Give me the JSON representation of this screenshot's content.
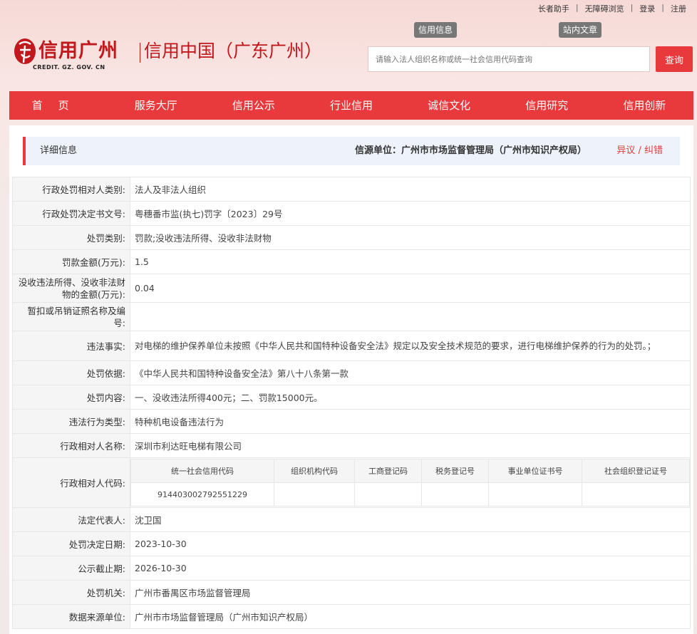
{
  "top_links": [
    "长者助手",
    "无障碍浏览",
    "登录",
    "注册"
  ],
  "logo": {
    "main": "信用广州",
    "sub": "CREDIT. GZ. GOV. CN",
    "secondary": "信用中国（广东广州）"
  },
  "search": {
    "tags": [
      "信用信息",
      "站内文章"
    ],
    "placeholder": "请输入法人组织名称或统一社会信用代码查询",
    "button": "查询"
  },
  "nav": [
    "首页",
    "服务大厅",
    "信用公示",
    "行业信用",
    "诚信文化",
    "信用研究",
    "信用创新"
  ],
  "detail": {
    "title": "详细信息",
    "source": "信源单位：广州市市场监督管理局（广州市知识产权局）",
    "action": "异议 / 纠错"
  },
  "rows": [
    {
      "k": "行政处罚相对人类别:",
      "v": "法人及非法人组织"
    },
    {
      "k": "行政处罚决定书文号:",
      "v": "粤穗番市监(执七)罚字〔2023〕29号"
    },
    {
      "k": "处罚类别:",
      "v": "罚款;没收违法所得、没收非法财物"
    },
    {
      "k": "罚款金额(万元):",
      "v": "1.5"
    },
    {
      "k": "没收违法所得、没收非法财物的金额(万元):",
      "v": "0.04"
    },
    {
      "k": "暂扣或吊销证照名称及编号:",
      "v": ""
    },
    {
      "k": "违法事实:",
      "v": "对电梯的维护保养单位未按照《中华人民共和国特种设备安全法》规定以及安全技术规范的要求，进行电梯维护保养的行为的处罚。；"
    },
    {
      "k": "处罚依据:",
      "v": "《中华人民共和国特种设备安全法》第八十八条第一款"
    },
    {
      "k": "处罚内容:",
      "v": "一、没收违法所得400元；二、罚款15000元。"
    },
    {
      "k": "违法行为类型:",
      "v": "特种机电设备违法行为"
    },
    {
      "k": "行政相对人名称:",
      "v": "深圳市利达旺电梯有限公司"
    }
  ],
  "code_row": {
    "k": "行政相对人代码:",
    "headers": [
      "统一社会信用代码",
      "组织机构代码",
      "工商登记码",
      "税务登记号",
      "事业单位证书号",
      "社会组织登记证号"
    ],
    "values": [
      "914403002792551229",
      "",
      "",
      "",
      "",
      ""
    ]
  },
  "rows2": [
    {
      "k": "法定代表人:",
      "v": "沈卫国"
    },
    {
      "k": "处罚决定日期:",
      "v": "2023-10-30"
    },
    {
      "k": "公示截止期:",
      "v": "2026-10-30"
    },
    {
      "k": "处罚机关:",
      "v": "广州市番禺区市场监督管理局"
    },
    {
      "k": "数据来源单位:",
      "v": "广州市市场监督管理局（广州市知识产权局）"
    }
  ]
}
